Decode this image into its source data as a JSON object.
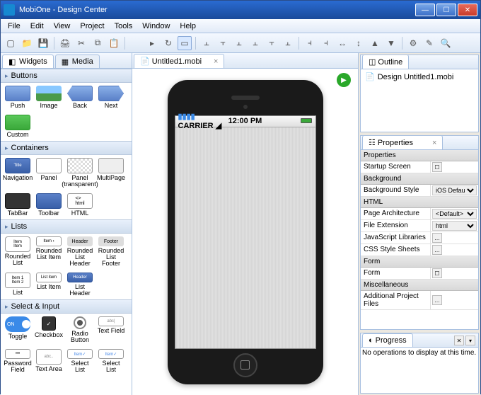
{
  "window": {
    "title": "MobiOne - Design Center"
  },
  "menu": [
    "File",
    "Edit",
    "View",
    "Project",
    "Tools",
    "Window",
    "Help"
  ],
  "left": {
    "tabs": [
      {
        "label": "Widgets"
      },
      {
        "label": "Media"
      }
    ],
    "categories": {
      "buttons": {
        "header": "Buttons",
        "items": [
          "Push",
          "Image",
          "Back",
          "Next",
          "Custom"
        ]
      },
      "containers": {
        "header": "Containers",
        "items": [
          "Navigation",
          "Panel",
          "Panel (transparent)",
          "MultiPage",
          "TabBar",
          "Toolbar",
          "HTML"
        ]
      },
      "lists": {
        "header": "Lists",
        "items": [
          "Rounded List",
          "Rounded List Item",
          "Rounded List Header",
          "Rounded List Footer",
          "List",
          "List Item",
          "List Header"
        ]
      },
      "select": {
        "header": "Select & Input",
        "items": [
          "Toggle",
          "Checkbox",
          "Radio Button",
          "Text Field",
          "Password Field",
          "Text Area",
          "Select List",
          "Select List"
        ]
      }
    }
  },
  "editor": {
    "tab": "Untitled1.mobi",
    "status": {
      "carrier": "CARRIER",
      "time": "12:00 PM"
    }
  },
  "outline": {
    "tab": "Outline",
    "item": "Design Untitled1.mobi"
  },
  "properties": {
    "tab": "Properties",
    "sections": {
      "properties": "Properties",
      "background": "Background",
      "html": "HTML",
      "form": "Form",
      "misc": "Miscellaneous"
    },
    "rows": {
      "startup": "Startup Screen",
      "bgstyle": "Background Style",
      "bgstyle_val": "iOS Default (strip...",
      "pagearch": "Page Architecture",
      "pagearch_val": "<Default>",
      "fileext": "File Extension",
      "fileext_val": "html",
      "jslib": "JavaScript Libraries",
      "css": "CSS Style Sheets",
      "form": "Form",
      "addfiles": "Additional Project Files"
    }
  },
  "progress": {
    "tab": "Progress",
    "empty": "No operations to display at this time."
  }
}
